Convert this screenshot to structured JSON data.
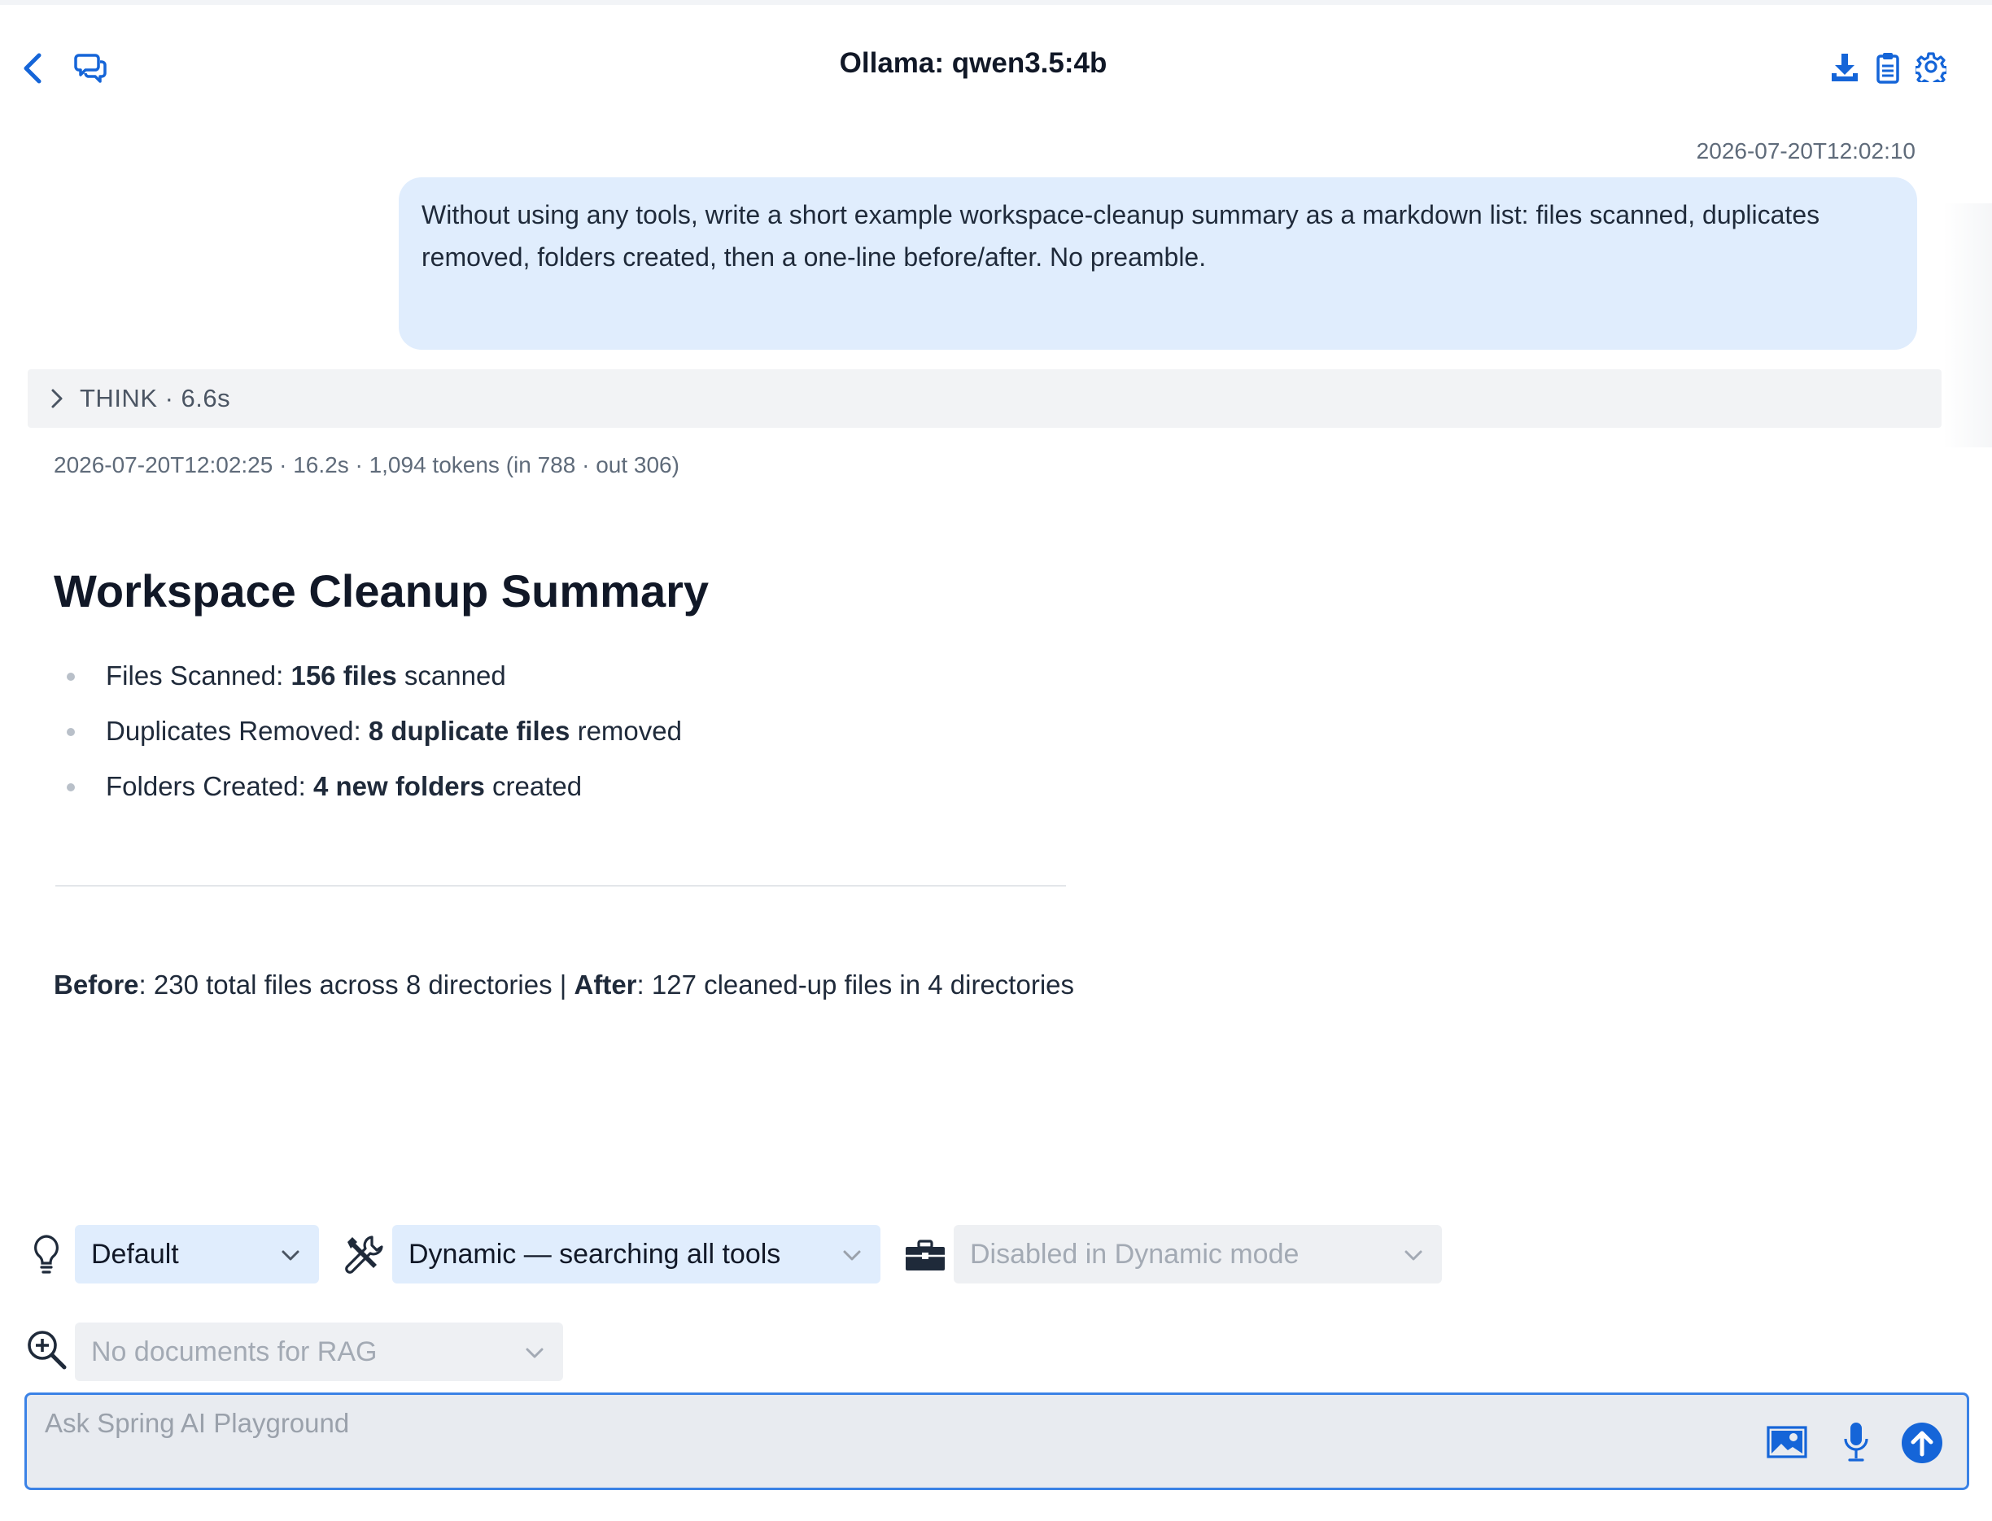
{
  "header": {
    "title": "Ollama: qwen3.5:4b",
    "icons": [
      "back-icon",
      "chat-bubbles-icon",
      "download-icon",
      "clipboard-icon",
      "gear-icon"
    ]
  },
  "conversation": {
    "user_message": {
      "timestamp": "2026-07-20T12:02:10",
      "text": "Without using any tools, write a short example workspace-cleanup summary as a markdown list: files scanned, duplicates removed, folders created, then a one-line before/after. No preamble."
    },
    "think": {
      "label": "THINK · 6.6s"
    },
    "assistant_message": {
      "meta": "2026-07-20T12:02:25 · 16.2s · 1,094 tokens (in 788 · out 306)",
      "title": "Workspace Cleanup Summary",
      "items": [
        {
          "label": "Files Scanned: ",
          "bold": "156 files",
          "suffix": " scanned"
        },
        {
          "label": "Duplicates Removed: ",
          "bold": "8 duplicate files",
          "suffix": " removed"
        },
        {
          "label": "Folders Created: ",
          "bold": "4 new folders",
          "suffix": " created"
        }
      ],
      "before_label": "Before",
      "before_text": ": 230 total files across 8 directories | ",
      "after_label": "After",
      "after_text": ": 127 cleaned-up files in 4 directories"
    }
  },
  "controls": {
    "prompt_select": "Default",
    "tools_select": "Dynamic — searching all tools",
    "toolkit_select": "Disabled in Dynamic mode",
    "rag_select": "No documents for RAG"
  },
  "input": {
    "placeholder": "Ask Spring AI Playground",
    "value": ""
  },
  "colors": {
    "accent": "#1565d8",
    "bubble": "#e0edfd",
    "think_bg": "#f2f3f5"
  }
}
